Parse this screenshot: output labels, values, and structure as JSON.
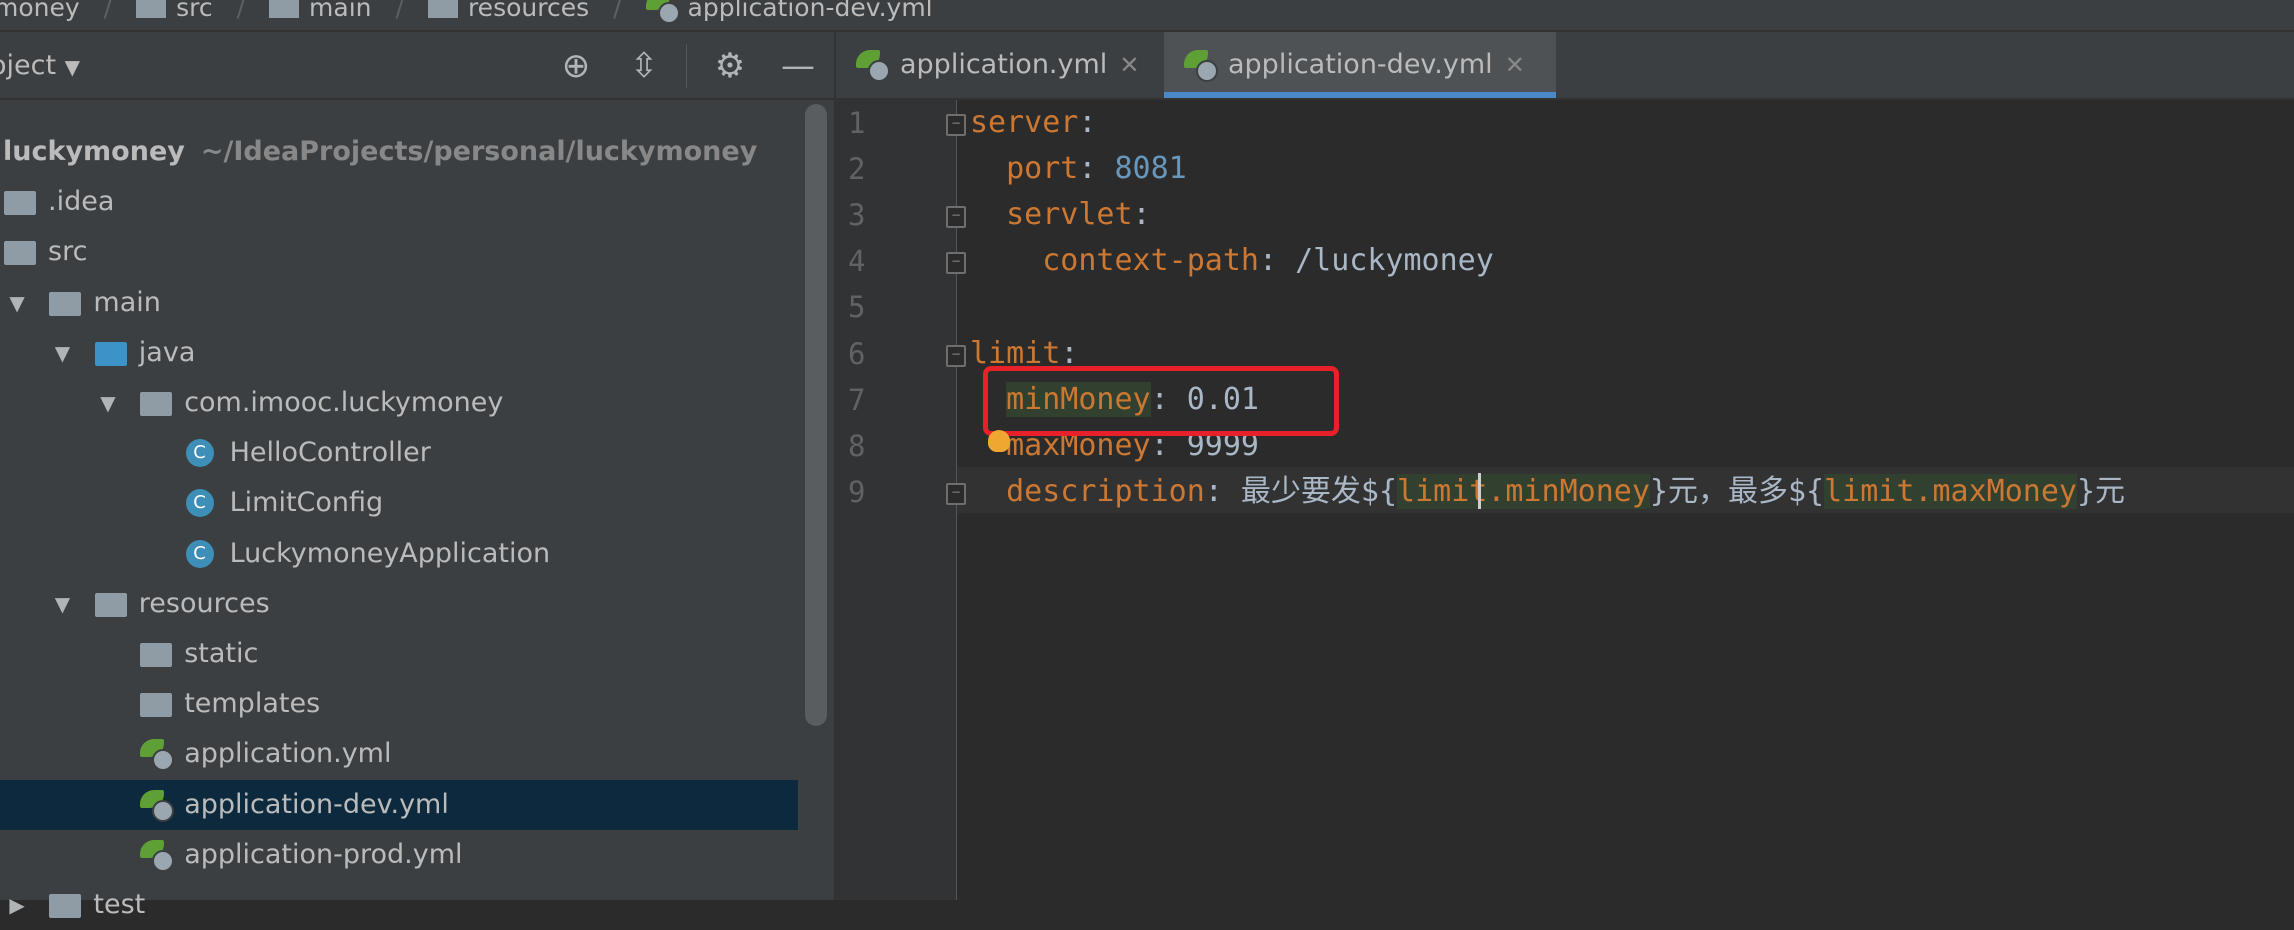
{
  "breadcrumb": [
    "money",
    "src",
    "main",
    "resources",
    "application-dev.yml"
  ],
  "sidebar": {
    "title": "oject",
    "toolbar": [
      "locate-icon",
      "collapse-all-icon",
      "gear-icon",
      "minimize-icon"
    ],
    "tree": [
      {
        "label": "luckymoney",
        "path": "~/IdeaProjects/personal/luckymoney",
        "level": -1,
        "icon": "none",
        "bold": true
      },
      {
        "label": ".idea",
        "level": 0,
        "icon": "folder"
      },
      {
        "label": "src",
        "level": 0,
        "icon": "folder"
      },
      {
        "label": "main",
        "level": 1,
        "icon": "folder",
        "expanded": true
      },
      {
        "label": "java",
        "level": 2,
        "icon": "folder-blue",
        "expanded": true
      },
      {
        "label": "com.imooc.luckymoney",
        "level": 3,
        "icon": "package",
        "expanded": true
      },
      {
        "label": "HelloController",
        "level": 4,
        "icon": "class"
      },
      {
        "label": "LimitConfig",
        "level": 4,
        "icon": "class"
      },
      {
        "label": "LuckymoneyApplication",
        "level": 4,
        "icon": "class"
      },
      {
        "label": "resources",
        "level": 2,
        "icon": "folder",
        "expanded": true
      },
      {
        "label": "static",
        "level": 3,
        "icon": "folder"
      },
      {
        "label": "templates",
        "level": 3,
        "icon": "folder"
      },
      {
        "label": "application.yml",
        "level": 3,
        "icon": "yml"
      },
      {
        "label": "application-dev.yml",
        "level": 3,
        "icon": "yml",
        "selected": true
      },
      {
        "label": "application-prod.yml",
        "level": 3,
        "icon": "yml"
      },
      {
        "label": "test",
        "level": 1,
        "icon": "folder",
        "collapsed": true
      }
    ]
  },
  "tabs": [
    {
      "label": "application.yml",
      "active": false
    },
    {
      "label": "application-dev.yml",
      "active": true
    }
  ],
  "editor": {
    "current_line": 9,
    "lines": [
      {
        "indent": 0,
        "fold": "open",
        "tokens": [
          [
            "server",
            "k"
          ],
          [
            ":",
            "p"
          ]
        ]
      },
      {
        "indent": 1,
        "tokens": [
          [
            "port",
            "k"
          ],
          [
            ": ",
            "p"
          ],
          [
            "8081",
            "n"
          ]
        ]
      },
      {
        "indent": 1,
        "fold": "open",
        "tokens": [
          [
            "servlet",
            "k"
          ],
          [
            ":",
            "p"
          ]
        ]
      },
      {
        "indent": 2,
        "fold": "close",
        "tokens": [
          [
            "context-path",
            "k"
          ],
          [
            ": ",
            "p"
          ],
          [
            "/luckymoney",
            "v"
          ]
        ]
      },
      {
        "indent": 0,
        "tokens": []
      },
      {
        "indent": 0,
        "fold": "open",
        "tokens": [
          [
            "limit",
            "k"
          ],
          [
            ":",
            "p"
          ]
        ]
      },
      {
        "indent": 1,
        "tokens": [
          [
            "minMoney",
            "k hl"
          ],
          [
            ": ",
            "p"
          ],
          [
            "0.01",
            "v"
          ]
        ]
      },
      {
        "indent": 1,
        "tokens": [
          [
            "maxMoney",
            "k"
          ],
          [
            ": ",
            "p"
          ],
          [
            "9999",
            "v"
          ]
        ]
      },
      {
        "indent": 1,
        "fold": "close",
        "tokens": [
          [
            "description",
            "k"
          ],
          [
            ": ",
            "p"
          ],
          [
            "最少要发${",
            "v"
          ],
          [
            "limit.minMoney",
            "k hl"
          ],
          [
            "}元，最多${",
            "v"
          ],
          [
            "limit.maxMoney",
            "k hl"
          ],
          [
            "}元",
            "v"
          ]
        ]
      }
    ]
  },
  "colors": {
    "accent": "#4a88c7",
    "highlight_box": "#e8202a",
    "keyword": "#cc7832",
    "number": "#6897bb",
    "selection": "#0d293e"
  }
}
